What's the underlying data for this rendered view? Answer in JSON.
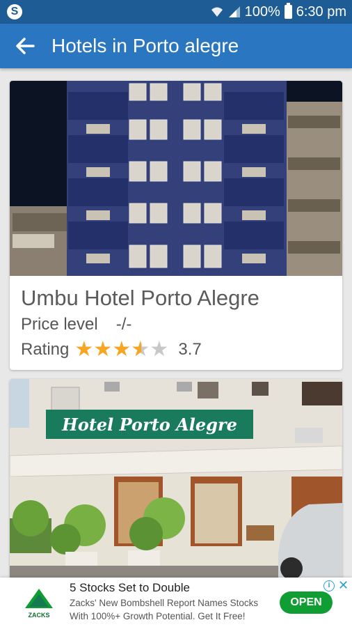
{
  "status_bar": {
    "battery": "100%",
    "time": "6:30 pm",
    "icons": [
      "skype-icon",
      "wifi-icon",
      "signal-icon",
      "battery-icon"
    ]
  },
  "app_bar": {
    "title": "Hotels in Porto alegre",
    "back_icon": "arrow-left-icon",
    "color": "#2a76c0"
  },
  "hotels": [
    {
      "name": "Umbu Hotel Porto Alegre",
      "price_label": "Price level",
      "price_value": "-/-",
      "rating_label": "Rating",
      "rating": "3.7",
      "rating_fraction": 0.74
    },
    {
      "sign": "Hotel Porto Alegre"
    }
  ],
  "ad": {
    "logo_text": "ZACKS",
    "title": "5 Stocks Set to Double",
    "text": "Zacks' New Bombshell Report Names Stocks With 100%+ Growth Potential. Get It Free!",
    "button": "OPEN",
    "button_color": "#0f9d34"
  }
}
